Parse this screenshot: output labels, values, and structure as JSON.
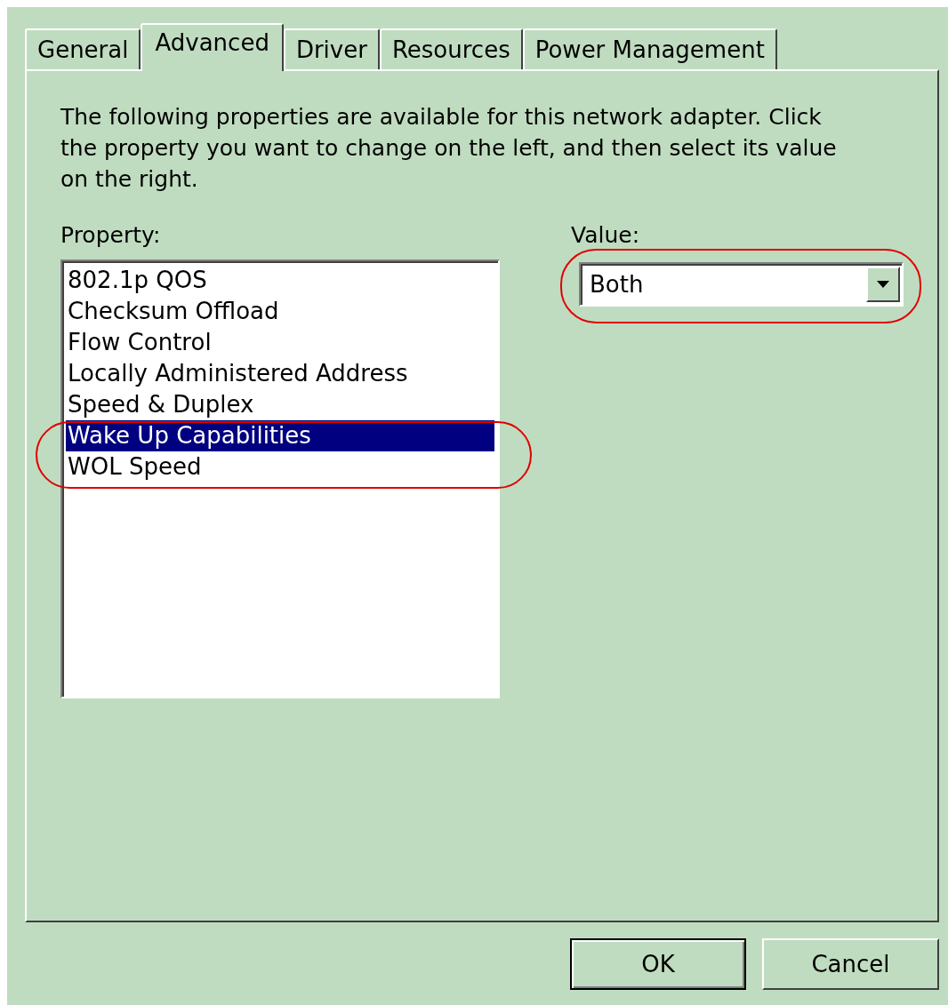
{
  "tabs": [
    {
      "label": "General",
      "selected": false
    },
    {
      "label": "Advanced",
      "selected": true
    },
    {
      "label": "Driver",
      "selected": false
    },
    {
      "label": "Resources",
      "selected": false
    },
    {
      "label": "Power Management",
      "selected": false
    }
  ],
  "description": "The following properties are available for this network adapter. Click the property you want to change on the left, and then select its value on the right.",
  "property": {
    "label": "Property:",
    "items": [
      {
        "label": "802.1p QOS",
        "selected": false
      },
      {
        "label": "Checksum Offload",
        "selected": false
      },
      {
        "label": "Flow Control",
        "selected": false
      },
      {
        "label": "Locally Administered Address",
        "selected": false
      },
      {
        "label": "Speed & Duplex",
        "selected": false
      },
      {
        "label": "Wake Up Capabilities",
        "selected": true
      },
      {
        "label": "WOL Speed",
        "selected": false
      }
    ]
  },
  "value": {
    "label": "Value:",
    "value": "Both"
  },
  "buttons": [
    "OK",
    "Cancel"
  ]
}
